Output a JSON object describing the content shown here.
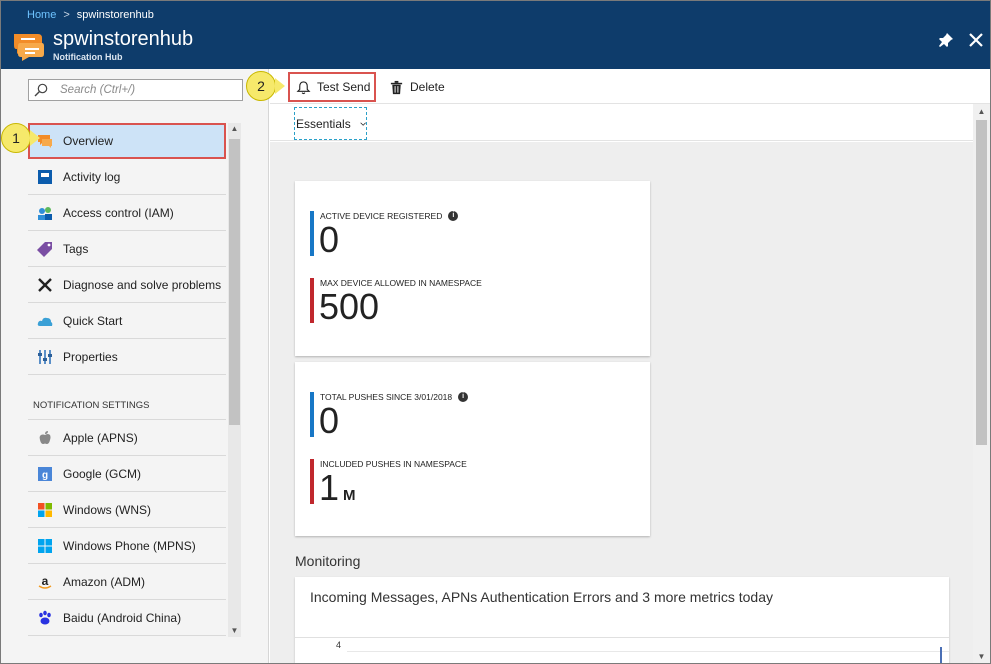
{
  "breadcrumb": {
    "home": "Home",
    "separator": ">",
    "current": "spwinstorenhub"
  },
  "header": {
    "title": "spwinstorenhub",
    "subtitle": "Notification Hub",
    "pin_icon": "pin-icon",
    "close_icon": "close-icon"
  },
  "search": {
    "placeholder": "Search (Ctrl+/)"
  },
  "sidebar": {
    "items": [
      {
        "label": "Overview",
        "icon": "overview-icon"
      },
      {
        "label": "Activity log",
        "icon": "activity-log-icon"
      },
      {
        "label": "Access control (IAM)",
        "icon": "people-icon"
      },
      {
        "label": "Tags",
        "icon": "tag-icon"
      },
      {
        "label": "Diagnose and solve problems",
        "icon": "wrench-icon"
      },
      {
        "label": "Quick Start",
        "icon": "cloud-icon"
      },
      {
        "label": "Properties",
        "icon": "properties-icon"
      }
    ],
    "section_header": "NOTIFICATION SETTINGS",
    "settings": [
      {
        "label": "Apple (APNS)",
        "icon": "apple-icon"
      },
      {
        "label": "Google (GCM)",
        "icon": "google-icon"
      },
      {
        "label": "Windows (WNS)",
        "icon": "windows-icon"
      },
      {
        "label": "Windows Phone (MPNS)",
        "icon": "windows-phone-icon"
      },
      {
        "label": "Amazon (ADM)",
        "icon": "amazon-icon"
      },
      {
        "label": "Baidu (Android China)",
        "icon": "baidu-icon"
      }
    ]
  },
  "callouts": {
    "one": "1",
    "two": "2"
  },
  "toolbar": {
    "test_send": "Test Send",
    "delete": "Delete"
  },
  "essentials": {
    "label": "Essentials"
  },
  "metrics": {
    "active_label": "ACTIVE DEVICE REGISTERED",
    "active_value": "0",
    "max_label": "MAX DEVICE ALLOWED IN NAMESPACE",
    "max_value": "500",
    "pushes_label": "TOTAL PUSHES SINCE 3/01/2018",
    "pushes_value": "0",
    "included_label": "INCLUDED PUSHES IN NAMESPACE",
    "included_value": "1",
    "included_unit": "M"
  },
  "monitoring": {
    "title": "Monitoring",
    "card_title": "Incoming Messages, APNs Authentication Errors and 3 more metrics today",
    "y_tick": "4"
  },
  "colors": {
    "header": "#0e3c6b",
    "accent_blue": "#1777c6",
    "accent_red": "#c0272d",
    "highlight": "#d9534f"
  }
}
